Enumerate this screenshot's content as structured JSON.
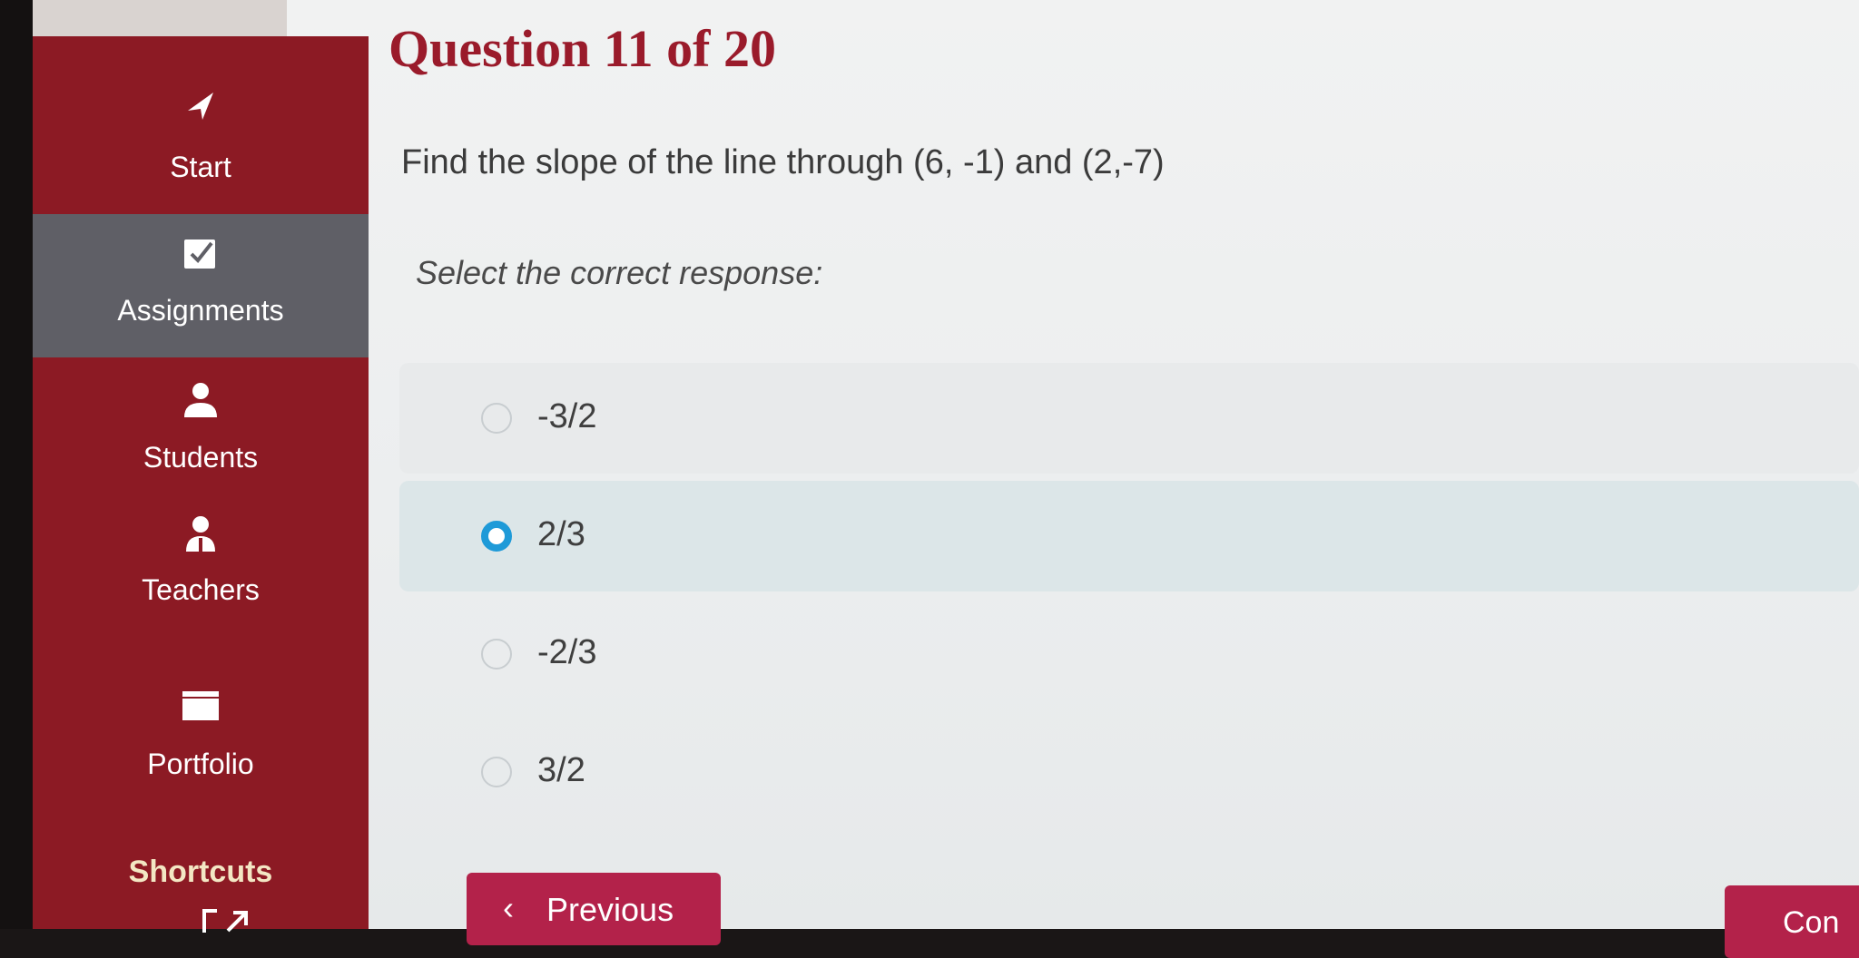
{
  "sidebar": {
    "items": [
      {
        "label": "Start",
        "icon": "send-arrow-icon"
      },
      {
        "label": "Assignments",
        "icon": "checkbox-icon"
      },
      {
        "label": "Students",
        "icon": "user-icon"
      },
      {
        "label": "Teachers",
        "icon": "teacher-icon"
      },
      {
        "label": "Portfolio",
        "icon": "folder-icon"
      }
    ],
    "active_index": 1,
    "shortcuts_label": "Shortcuts"
  },
  "question": {
    "title": "Question 11 of 20",
    "text": "Find the slope of the line through (6, -1) and (2,-7)",
    "instruction": "Select the correct response:",
    "options": [
      "-3/2",
      "2/3",
      "-2/3",
      "3/2"
    ],
    "selected_index": 1
  },
  "nav": {
    "previous_label": "Previous",
    "continue_label": "Con"
  },
  "colors": {
    "sidebar": "#8c1a24",
    "sidebar_active": "#5f5f66",
    "title": "#9a1b2b",
    "button": "#b3224a",
    "radio_selected": "#1e9ad8"
  }
}
